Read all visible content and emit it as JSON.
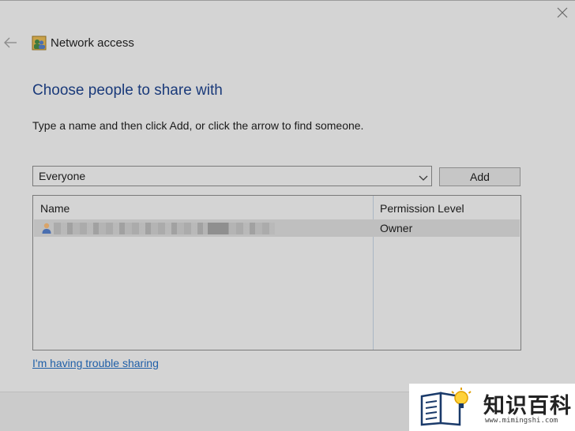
{
  "window": {
    "title": "Network access",
    "close_icon": "close-icon",
    "back_icon": "back-arrow-icon",
    "app_icon": "users-icon"
  },
  "main": {
    "heading": "Choose people to share with",
    "instruction": "Type a name and then click Add, or click the arrow to find someone."
  },
  "picker": {
    "value": "Everyone",
    "dropdown_icon": "chevron-down-icon",
    "add_label": "Add"
  },
  "table": {
    "columns": [
      "Name",
      "Permission Level"
    ],
    "rows": [
      {
        "name": "",
        "name_redacted": true,
        "permission": "Owner",
        "selected": true
      }
    ]
  },
  "links": {
    "trouble": "I'm having trouble sharing"
  },
  "watermark": {
    "title": "知识百科",
    "url": "www.mimingshi.com"
  },
  "colors": {
    "background": "#d4d4d4",
    "heading": "#1a3a7a",
    "link": "#1f5fa8",
    "selection": "#bfbfbf"
  }
}
